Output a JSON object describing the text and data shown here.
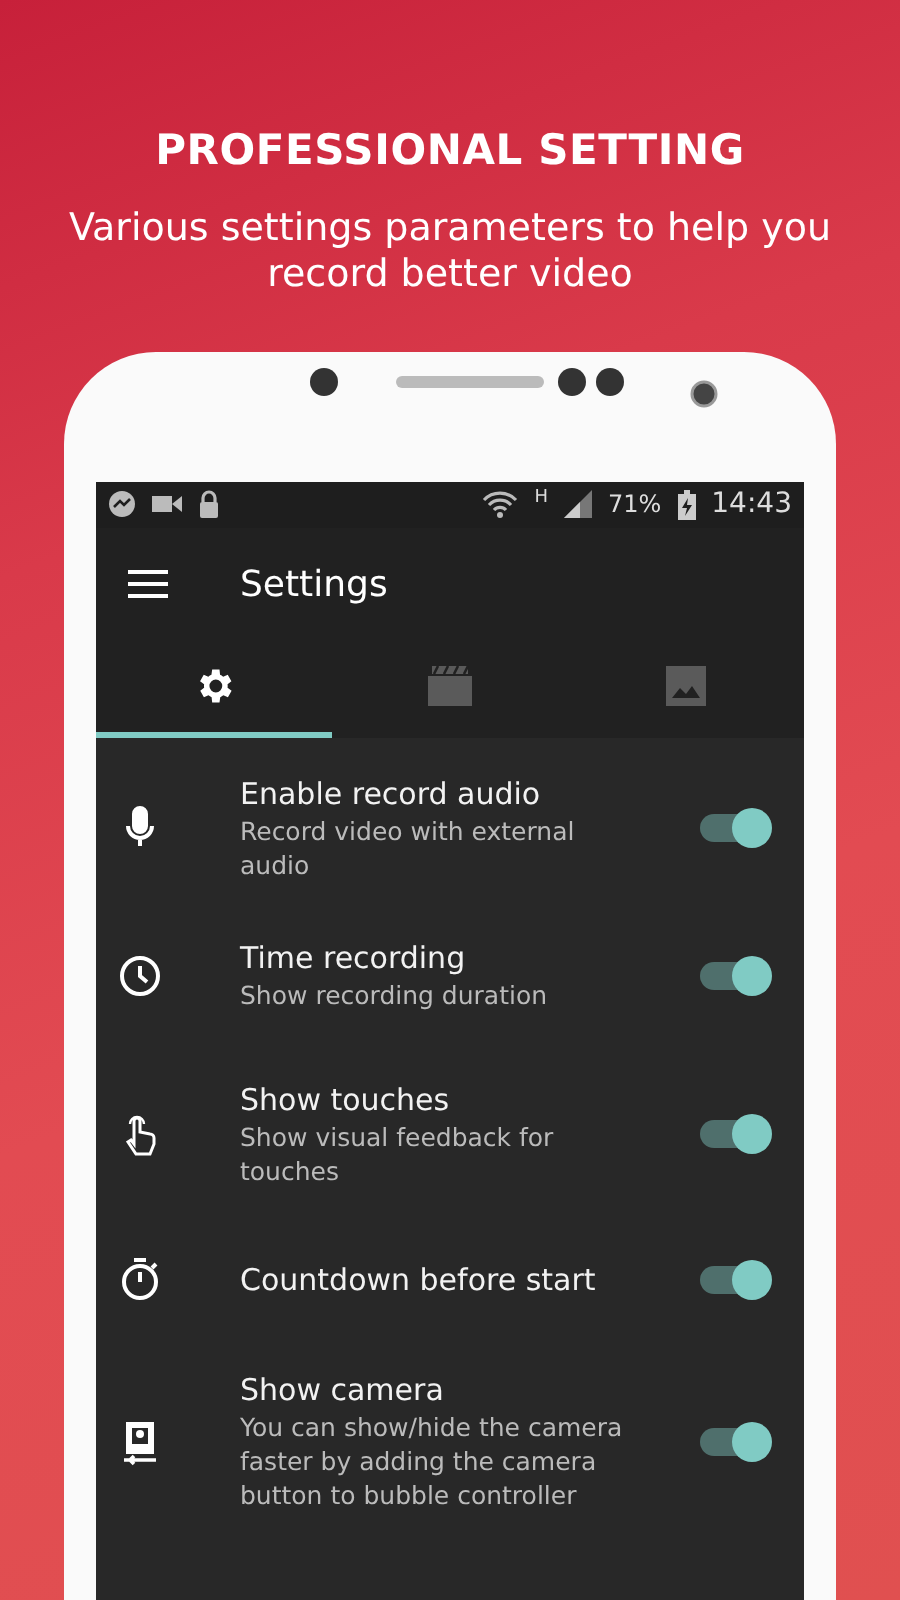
{
  "headline": "PROFESSIONAL SETTING",
  "subtitle": "Various settings parameters to help you record better video",
  "status_bar": {
    "network": "H",
    "battery": "71%",
    "time": "14:43"
  },
  "toolbar": {
    "title": "Settings"
  },
  "tabs": [
    {
      "kind": "settings",
      "selected": true
    },
    {
      "kind": "video",
      "selected": false
    },
    {
      "kind": "image",
      "selected": false
    }
  ],
  "settings": [
    {
      "kind": "mic",
      "title": "Enable record audio",
      "summary": "Record video with external audio",
      "on": true
    },
    {
      "kind": "clock",
      "title": "Time recording",
      "summary": "Show recording duration",
      "on": true
    },
    {
      "kind": "touch",
      "title": "Show touches",
      "summary": "Show visual feedback for touches",
      "on": true
    },
    {
      "kind": "timer",
      "title": "Countdown before start",
      "on": true
    },
    {
      "kind": "camera",
      "title": "Show camera",
      "summary": "You can show/hide the camera faster by adding the camera button to bubble controller",
      "on": true
    }
  ]
}
